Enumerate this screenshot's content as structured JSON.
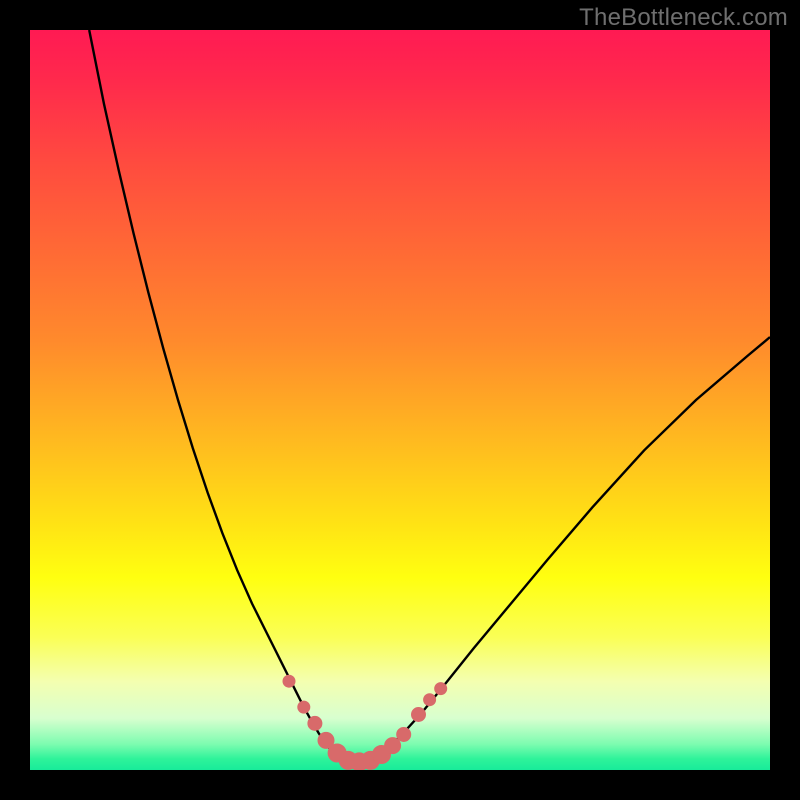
{
  "watermark": "TheBottleneck.com",
  "colors": {
    "frame": "#000000",
    "curve_stroke": "#000000",
    "marker_fill": "#d86a6a",
    "marker_stroke": "#d86a6a",
    "gradient_stops": [
      {
        "offset": 0.0,
        "color": "#ff1a53"
      },
      {
        "offset": 0.07,
        "color": "#ff2a4c"
      },
      {
        "offset": 0.18,
        "color": "#ff4b3f"
      },
      {
        "offset": 0.3,
        "color": "#ff6a35"
      },
      {
        "offset": 0.42,
        "color": "#ff8a2c"
      },
      {
        "offset": 0.55,
        "color": "#ffb820"
      },
      {
        "offset": 0.66,
        "color": "#ffe015"
      },
      {
        "offset": 0.74,
        "color": "#ffff10"
      },
      {
        "offset": 0.82,
        "color": "#faff55"
      },
      {
        "offset": 0.88,
        "color": "#f4ffb0"
      },
      {
        "offset": 0.93,
        "color": "#d8ffcf"
      },
      {
        "offset": 0.965,
        "color": "#7dfcb0"
      },
      {
        "offset": 0.985,
        "color": "#2ef39a"
      },
      {
        "offset": 1.0,
        "color": "#18eb9a"
      }
    ]
  },
  "chart_data": {
    "type": "line",
    "title": "",
    "xlabel": "",
    "ylabel": "",
    "xlim": [
      0,
      100
    ],
    "ylim": [
      0,
      100
    ],
    "series": [
      {
        "name": "bottleneck-curve",
        "x": [
          8,
          10,
          12,
          14,
          16,
          18,
          20,
          22,
          24,
          26,
          28,
          30,
          31,
          32,
          33,
          34,
          35,
          36,
          37,
          38,
          39,
          40,
          41,
          42,
          43,
          44,
          46,
          48,
          50,
          53,
          56,
          60,
          65,
          70,
          76,
          83,
          90,
          97,
          100
        ],
        "y": [
          100,
          90,
          81,
          72.5,
          64.5,
          57,
          50,
          43.5,
          37.5,
          32,
          27,
          22.5,
          20.5,
          18.5,
          16.5,
          14.5,
          12.5,
          10.5,
          8.5,
          6.7,
          5.0,
          3.5,
          2.3,
          1.5,
          1.1,
          1.1,
          1.5,
          2.7,
          4.5,
          7.8,
          11.5,
          16.5,
          22.5,
          28.5,
          35.5,
          43.2,
          50,
          56,
          58.5
        ]
      }
    ],
    "markers": {
      "name": "highlight-points",
      "x": [
        35.0,
        37.0,
        38.5,
        40.0,
        41.5,
        43.0,
        44.5,
        46.0,
        47.5,
        49.0,
        50.5,
        52.5,
        54.0,
        55.5
      ],
      "y": [
        12.0,
        8.5,
        6.3,
        4.0,
        2.3,
        1.3,
        1.1,
        1.3,
        2.1,
        3.3,
        4.8,
        7.5,
        9.5,
        11.0
      ],
      "r": [
        6,
        6,
        7,
        8,
        9,
        9,
        9,
        9,
        9,
        8,
        7,
        7,
        6,
        6
      ]
    }
  }
}
